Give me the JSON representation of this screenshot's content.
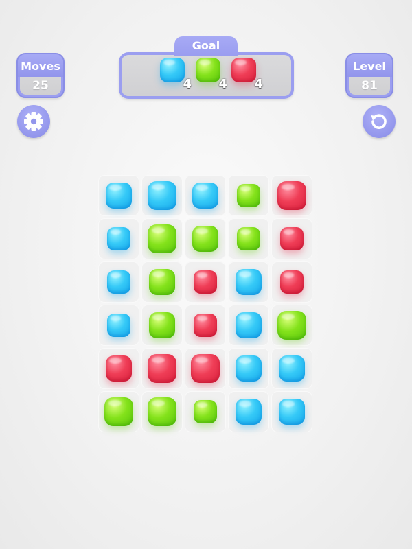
{
  "hud": {
    "moves_label": "Moves",
    "moves_value": "25",
    "level_label": "Level",
    "level_value": "81",
    "goal_label": "Goal"
  },
  "goals": [
    {
      "color": "blue",
      "count": "4"
    },
    {
      "color": "green",
      "count": "4"
    },
    {
      "color": "red",
      "count": "4"
    }
  ],
  "buttons": {
    "settings_icon": "gear-icon",
    "restart_icon": "restart-icon"
  },
  "colors": {
    "blue": "#2ec3f5",
    "green": "#7ddc16",
    "red": "#ea3550",
    "hud_purple": "#9b9ef0"
  },
  "board": {
    "rows": 6,
    "cols": 5,
    "grid": [
      [
        "blue",
        "blue",
        "blue",
        "green",
        "red"
      ],
      [
        "blue",
        "green",
        "green",
        "green",
        "red"
      ],
      [
        "blue",
        "green",
        "red",
        "blue",
        "red"
      ],
      [
        "blue",
        "green",
        "red",
        "blue",
        "green"
      ],
      [
        "red",
        "red",
        "red",
        "blue",
        "blue"
      ],
      [
        "green",
        "green",
        "green",
        "blue",
        "blue"
      ]
    ]
  }
}
